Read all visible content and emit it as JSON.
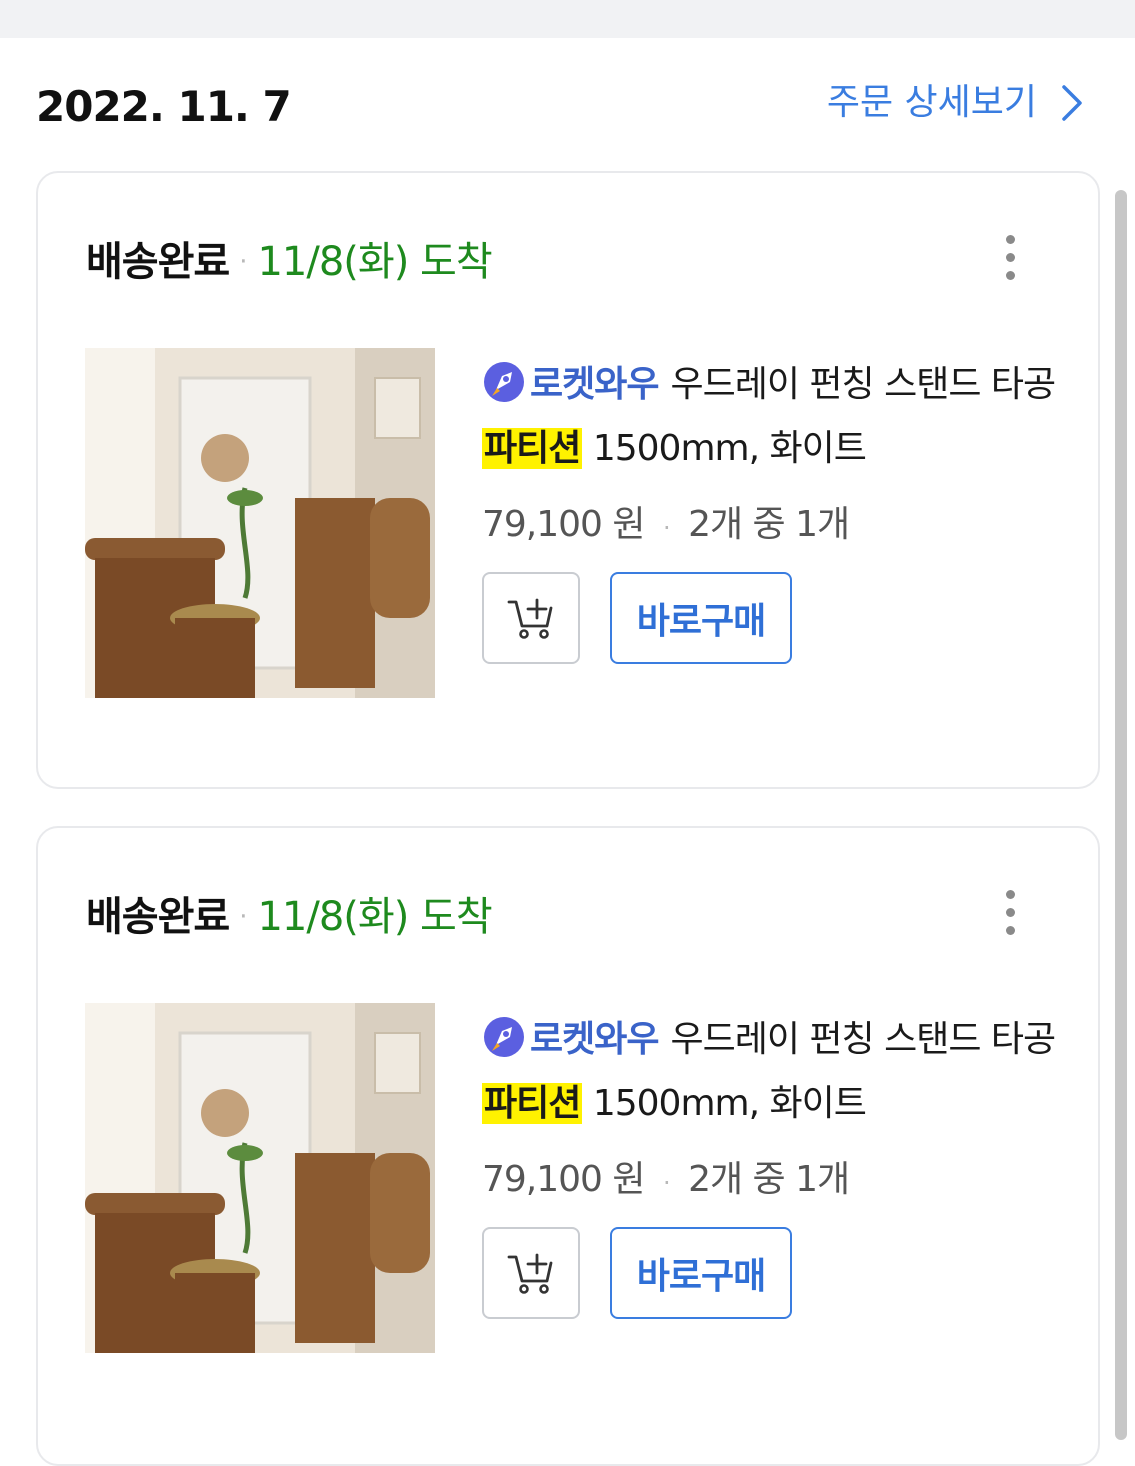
{
  "order": {
    "date": "2022. 11. 7",
    "detail_link": "주문 상세보기"
  },
  "items": [
    {
      "status": "배송완료",
      "separator": "·",
      "arrival": "11/8(화) 도착",
      "badge": "로켓와우",
      "title_pre": "우드레이 펀칭 스탠드 타공",
      "title_highlight": "파티션",
      "title_post": "1500mm, 화이트",
      "price": "79,100 원",
      "quantity": "2개 중 1개",
      "buy_label": "바로구매"
    },
    {
      "status": "배송완료",
      "separator": "·",
      "arrival": "11/8(화) 도착",
      "badge": "로켓와우",
      "title_pre": "우드레이 펀칭 스탠드 타공",
      "title_highlight": "파티션",
      "title_post": "1500mm, 화이트",
      "price": "79,100 원",
      "quantity": "2개 중 1개",
      "buy_label": "바로구매"
    }
  ],
  "colors": {
    "accent_blue": "#3a7de0",
    "arrival_green": "#1e8a1e",
    "highlight_yellow": "#fff200"
  },
  "icons": {
    "more": "more-vertical-icon",
    "cart": "add-to-cart-icon",
    "chevron": "chevron-right-icon",
    "rocket": "rocket-wow-icon"
  }
}
